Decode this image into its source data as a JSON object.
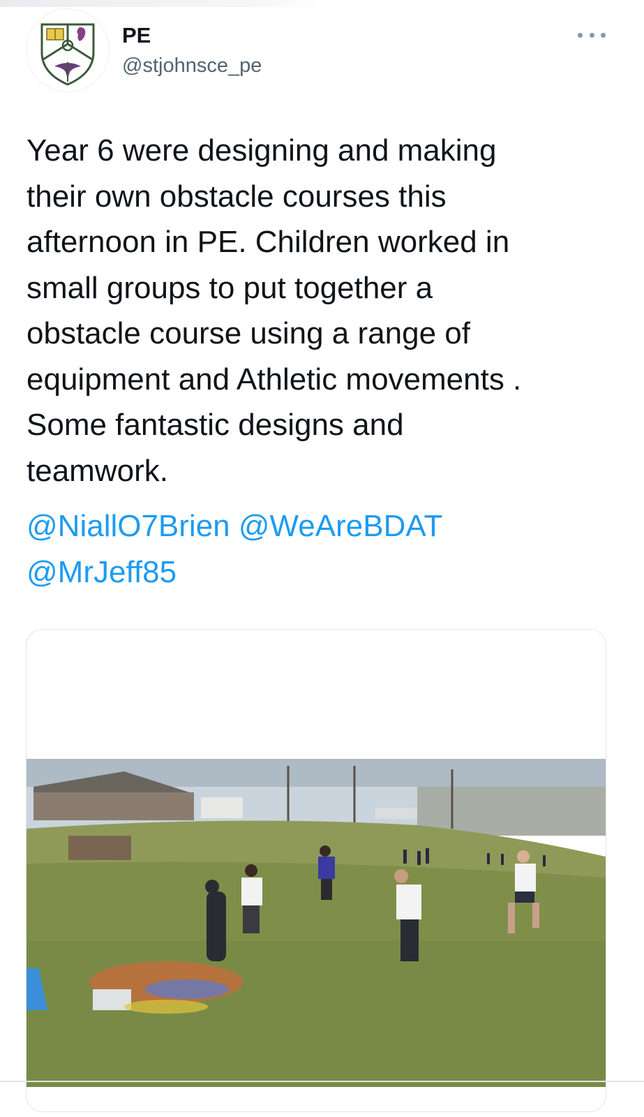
{
  "tweet": {
    "author": {
      "display_name": "PE",
      "handle": "@stjohnsce_pe",
      "avatar_icon": "school-crest-icon"
    },
    "more_icon": "more-options-icon",
    "text_lines": [
      "Year 6 were designing and making",
      "their own obstacle courses this",
      "afternoon in PE. Children worked in",
      "small groups to put together a",
      "obstacle course using a range of",
      "equipment and Athletic movements .",
      "Some fantastic designs and",
      "teamwork."
    ],
    "mentions": [
      "@NiallO7Brien",
      "@WeAreBDAT",
      "@MrJeff85"
    ],
    "media": {
      "type": "video",
      "description_icon": "video-thumbnail"
    }
  },
  "colors": {
    "text": "#0f1419",
    "secondary": "#536471",
    "link": "#1d9bf0",
    "border": "#e3e7ea"
  }
}
